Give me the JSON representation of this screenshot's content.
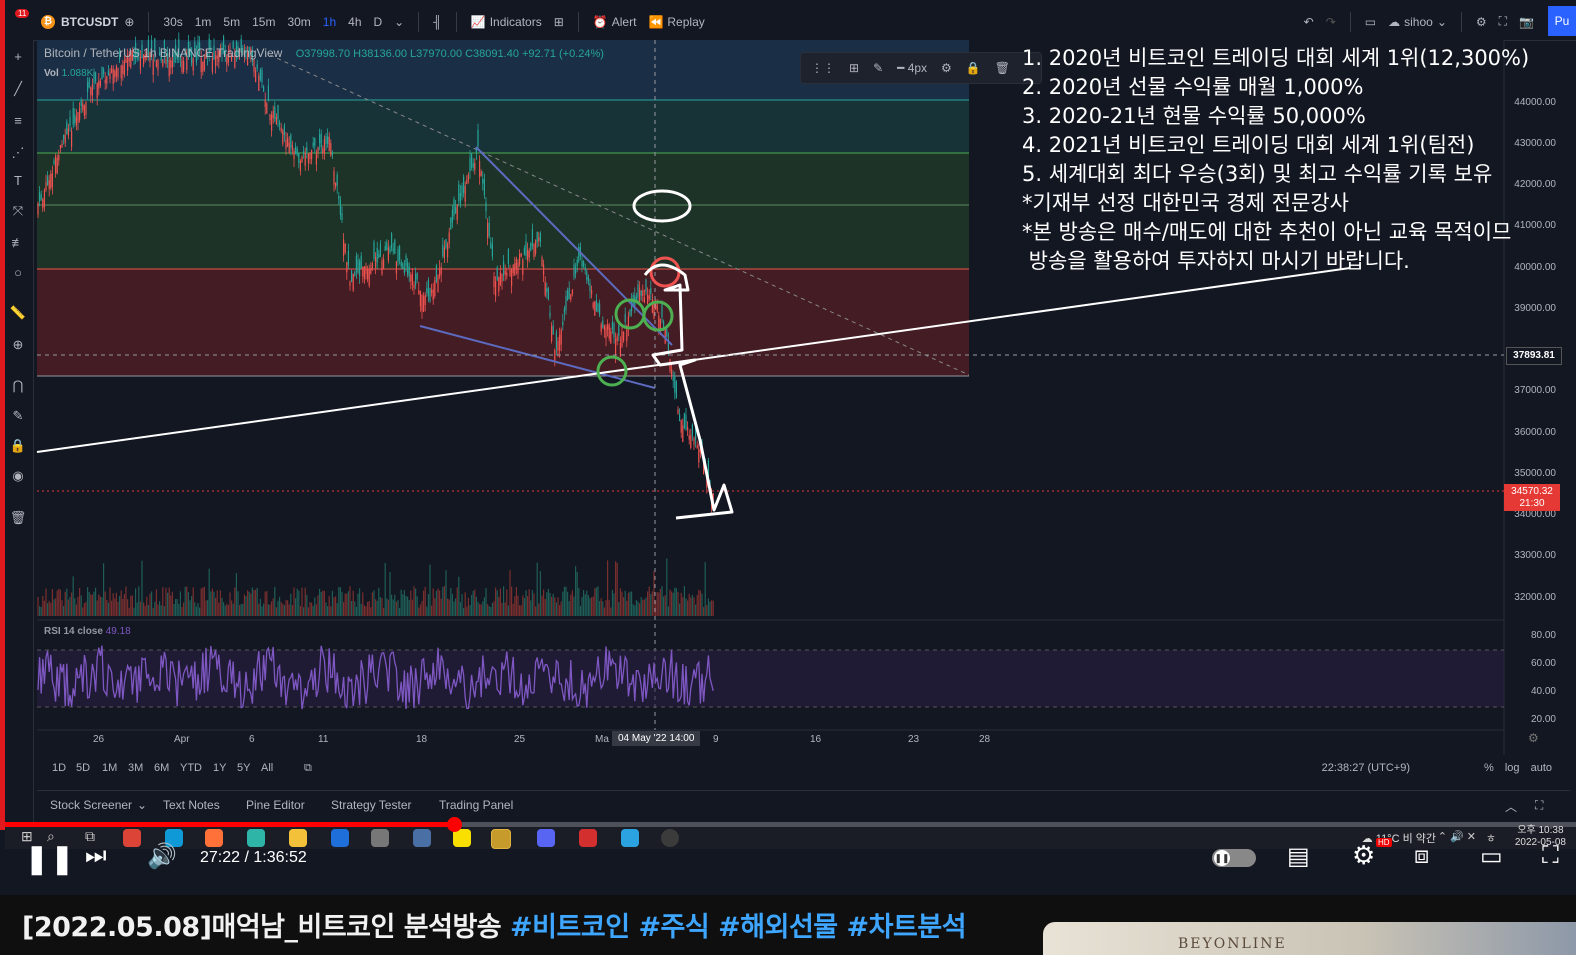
{
  "app": {
    "symbol": "BTCUSDT",
    "notification_count": "11",
    "timeframes": [
      "30s",
      "1m",
      "5m",
      "15m",
      "30m",
      "1h",
      "4h",
      "D"
    ],
    "active_timeframe": "1h",
    "indicators_label": "Indicators",
    "alert_label": "Alert",
    "replay_label": "Replay",
    "user_label": "sihoo",
    "publish_label": "Pu"
  },
  "legend": {
    "title": "Bitcoin / TetherUS  1h  BINANCE  TradingView",
    "ohlc": "O37998.70 H38136.00 L37970.00 C38091.40 +92.71 (+0.24%)",
    "vol_label": "Vol",
    "vol_value": "1.088K",
    "rsi_label": "RSI 14 close",
    "rsi_value": "49.18"
  },
  "draw_toolbar": {
    "width_label": "4px"
  },
  "overlay_notes": [
    "1. 2020년 비트코인 트레이딩 대회 세계 1위(12,300%)",
    "2. 2020년 선물 수익률 매월 1,000%",
    "3. 2020-21년 현물 수익률 50,000%",
    "4. 2021년 비트코인 트레이딩 대회 세계 1위(팀전)",
    "5. 세계대회 최다 우승(3회) 및 최고 수익률 기록 보유",
    "*기재부 선정 대한민국 경제 전문강사",
    "*본 방송은 매수/매도에 대한 추천이 아닌 교육 목적이므",
    " 방송을 활용하여 투자하지 마시기 바랍니다."
  ],
  "price_axis": [
    "44000.00",
    "43000.00",
    "42000.00",
    "41000.00",
    "40000.00",
    "39000.00",
    "37000.00",
    "36000.00",
    "35000.00",
    "34000.00",
    "33000.00",
    "32000.00"
  ],
  "rsi_axis": [
    "80.00",
    "60.00",
    "40.00",
    "20.00"
  ],
  "crosshair_price": "37893.81",
  "last_price": {
    "price": "34570.32",
    "countdown": "21:30"
  },
  "time_axis": [
    "26",
    "Apr",
    "6",
    "11",
    "18",
    "25",
    "Ma",
    "9",
    "16",
    "23",
    "28"
  ],
  "crosshair_time": "04 May '22   14:00",
  "ranges": [
    "1D",
    "5D",
    "1M",
    "3M",
    "6M",
    "YTD",
    "1Y",
    "5Y",
    "All"
  ],
  "timezone": "22:38:27 (UTC+9)",
  "scale_options": "%  log  auto",
  "bottom_tabs": [
    "Stock Screener",
    "Text Notes",
    "Pine Editor",
    "Strategy Tester",
    "Trading Panel"
  ],
  "taskbar": {
    "weather": "11°C  비 약간",
    "time": "오후 10:38",
    "date": "2022-05-08"
  },
  "player": {
    "current_time": "27:22 / 1:36:52",
    "progress_fraction": 0.286
  },
  "video_title": {
    "main": "[2022.05.08]매억남_비트코인 분석방송",
    "tags": [
      "#비트코인",
      "#주식",
      "#해외선물",
      "#차트분석"
    ]
  },
  "ad": {
    "text": "BEYONLINE"
  },
  "colors": {
    "accent": "#2962ff",
    "youtube_red": "#ff0000",
    "up": "#26a69a",
    "down": "#ef5350",
    "rsi": "#7e57c2"
  }
}
